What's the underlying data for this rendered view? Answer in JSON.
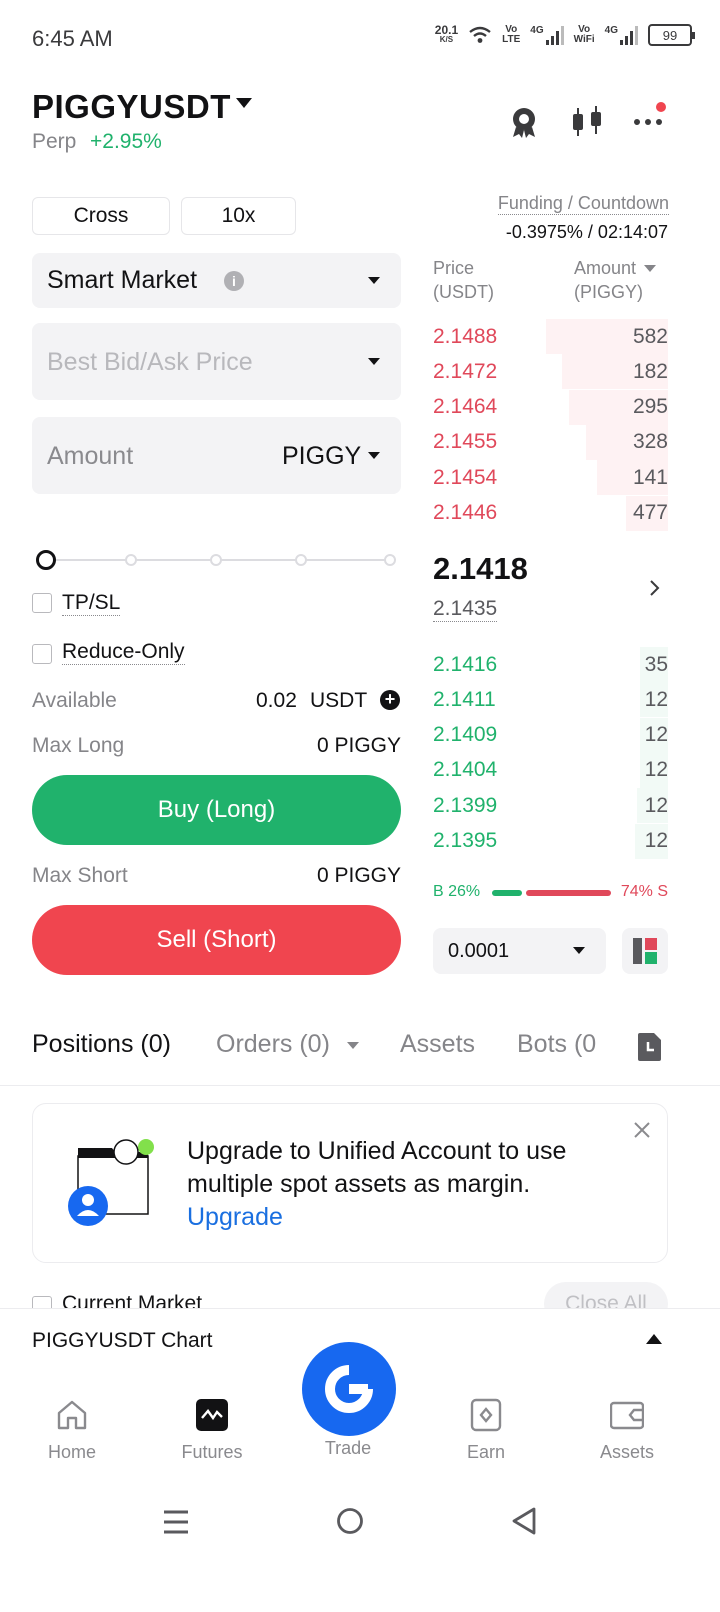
{
  "status_bar": {
    "time": "6:45 AM",
    "speed_value": "20.1",
    "speed_unit": "K/S",
    "vo_lte_1": "Vo",
    "vo_lte_2": "LTE",
    "net1": "4G",
    "vo_wifi_1": "Vo",
    "vo_wifi_2": "WiFi",
    "net2": "4G",
    "battery": "99"
  },
  "header": {
    "pair": "PIGGYUSDT",
    "contract_type": "Perp",
    "change": "+2.95%",
    "icons": [
      "badge-icon",
      "candlestick-icon",
      "more-icon"
    ]
  },
  "order_form": {
    "margin_mode": "Cross",
    "leverage": "10x",
    "order_type": "Smart Market",
    "price_placeholder": "Best Bid/Ask Price",
    "amount_placeholder": "Amount",
    "amount_unit": "PIGGY",
    "tpsl_label": "TP/SL",
    "reduce_only_label": "Reduce-Only",
    "available_label": "Available",
    "available_value": "0.02",
    "available_unit": "USDT",
    "max_long_label": "Max Long",
    "max_long_value": "0 PIGGY",
    "buy_label": "Buy (Long)",
    "max_short_label": "Max Short",
    "max_short_value": "0 PIGGY",
    "sell_label": "Sell (Short)"
  },
  "funding": {
    "label": "Funding / Countdown",
    "value": "-0.3975% / 02:14:07"
  },
  "order_book": {
    "price_header_1": "Price",
    "price_header_2": "(USDT)",
    "amount_header_1": "Amount",
    "amount_header_2": "(PIGGY)",
    "asks": [
      {
        "price": "2.1488",
        "amount": "582",
        "depth": 0.52
      },
      {
        "price": "2.1472",
        "amount": "182",
        "depth": 0.45
      },
      {
        "price": "2.1464",
        "amount": "295",
        "depth": 0.42
      },
      {
        "price": "2.1455",
        "amount": "328",
        "depth": 0.35
      },
      {
        "price": "2.1454",
        "amount": "141",
        "depth": 0.3
      },
      {
        "price": "2.1446",
        "amount": "477",
        "depth": 0.18
      }
    ],
    "last_price": "2.1418",
    "mark_price": "2.1435",
    "bids": [
      {
        "price": "2.1416",
        "amount": "35",
        "depth": 0.12
      },
      {
        "price": "2.1411",
        "amount": "12",
        "depth": 0.12
      },
      {
        "price": "2.1409",
        "amount": "12",
        "depth": 0.12
      },
      {
        "price": "2.1404",
        "amount": "12",
        "depth": 0.12
      },
      {
        "price": "2.1399",
        "amount": "12",
        "depth": 0.13
      },
      {
        "price": "2.1395",
        "amount": "12",
        "depth": 0.14
      }
    ],
    "buy_ratio_label": "B 26%",
    "sell_ratio_label": "74% S",
    "buy_ratio": 0.26,
    "precision": "0.0001"
  },
  "tabs": {
    "positions": "Positions (0)",
    "orders": "Orders (0)",
    "assets": "Assets",
    "bots": "Bots (0"
  },
  "banner": {
    "text": "Upgrade to Unified Account to use multiple spot assets as margin.",
    "link": "Upgrade"
  },
  "list_controls": {
    "current_market": "Current Market",
    "close_all": "Close All"
  },
  "chart_bar": {
    "label": "PIGGYUSDT Chart"
  },
  "bottom_nav": {
    "home": "Home",
    "futures": "Futures",
    "trade": "Trade",
    "earn": "Earn",
    "assets": "Assets"
  },
  "colors": {
    "green": "#20b26c",
    "red": "#f0454f",
    "blue": "#1768f0"
  }
}
